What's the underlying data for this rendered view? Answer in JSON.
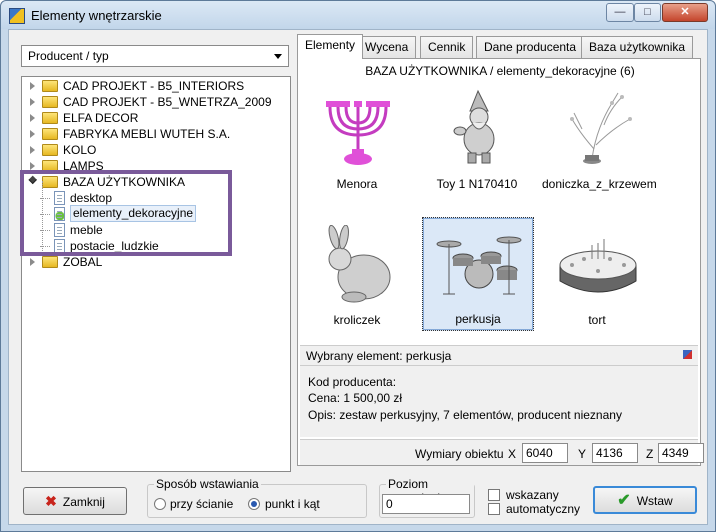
{
  "window": {
    "title": "Elementy wnętrzarskie",
    "minimize": "—",
    "maximize": "□",
    "close": "✕"
  },
  "left": {
    "combo_value": "Producent / typ",
    "tree": [
      {
        "label": "CAD PROJEKT - B5_INTERIORS",
        "type": "folder"
      },
      {
        "label": "CAD PROJEKT - B5_WNETRZA_2009",
        "type": "folder"
      },
      {
        "label": "ELFA DECOR",
        "type": "folder"
      },
      {
        "label": "FABRYKA MEBLI WUTEH S.A.",
        "type": "folder"
      },
      {
        "label": "KOLO",
        "type": "folder"
      },
      {
        "label": "LAMPS",
        "type": "folder"
      },
      {
        "label": "BAZA UŻYTKOWNIKA",
        "type": "folder-open"
      },
      {
        "label": "desktop",
        "type": "doc"
      },
      {
        "label": "elementy_dekoracyjne",
        "type": "doc-selected"
      },
      {
        "label": "meble",
        "type": "doc"
      },
      {
        "label": "postacie_ludzkie",
        "type": "doc"
      },
      {
        "label": "ZOBAL",
        "type": "folder"
      }
    ]
  },
  "tabs": [
    "Elementy",
    "Wycena",
    "Cennik",
    "Dane producenta",
    "Baza użytkownika"
  ],
  "breadcrumb": "BAZA UŻYTKOWNIKA / elementy_dekoracyjne (6)",
  "gallery": [
    {
      "name": "Menora",
      "icon": "menorah-icon"
    },
    {
      "name": "Toy 1 N170410",
      "icon": "gnome-icon"
    },
    {
      "name": "doniczka_z_krzewem",
      "icon": "plant-pot-icon"
    },
    {
      "name": "kroliczek",
      "icon": "rabbit-icon"
    },
    {
      "name": "perkusja",
      "icon": "drum-kit-icon"
    },
    {
      "name": "tort",
      "icon": "cake-icon"
    }
  ],
  "selected_info": "Wybrany element: perkusja",
  "details": {
    "kod": "Kod producenta:",
    "cena": "Cena: 1 500,00 zł",
    "opis": "Opis: zestaw perkusyjny, 7 elementów, producent nieznany"
  },
  "dims": {
    "label": "Wymiary obiektu",
    "x_label": "X",
    "x": "6040",
    "y_label": "Y",
    "y": "4136",
    "z_label": "Z",
    "z": "4349"
  },
  "bottom": {
    "close_label": "Zamknij",
    "method_title": "Sposób wstawiania",
    "method_wall": "przy ścianie",
    "method_point": "punkt i kąt",
    "level_title": "Poziom wstawienia",
    "level_value": "0",
    "cb_shown": "wskazany",
    "cb_auto": "automatyczny",
    "insert_label": "Wstaw"
  },
  "colors": {
    "highlight": "#7a5a9a",
    "accent": "#3a8ad8"
  }
}
